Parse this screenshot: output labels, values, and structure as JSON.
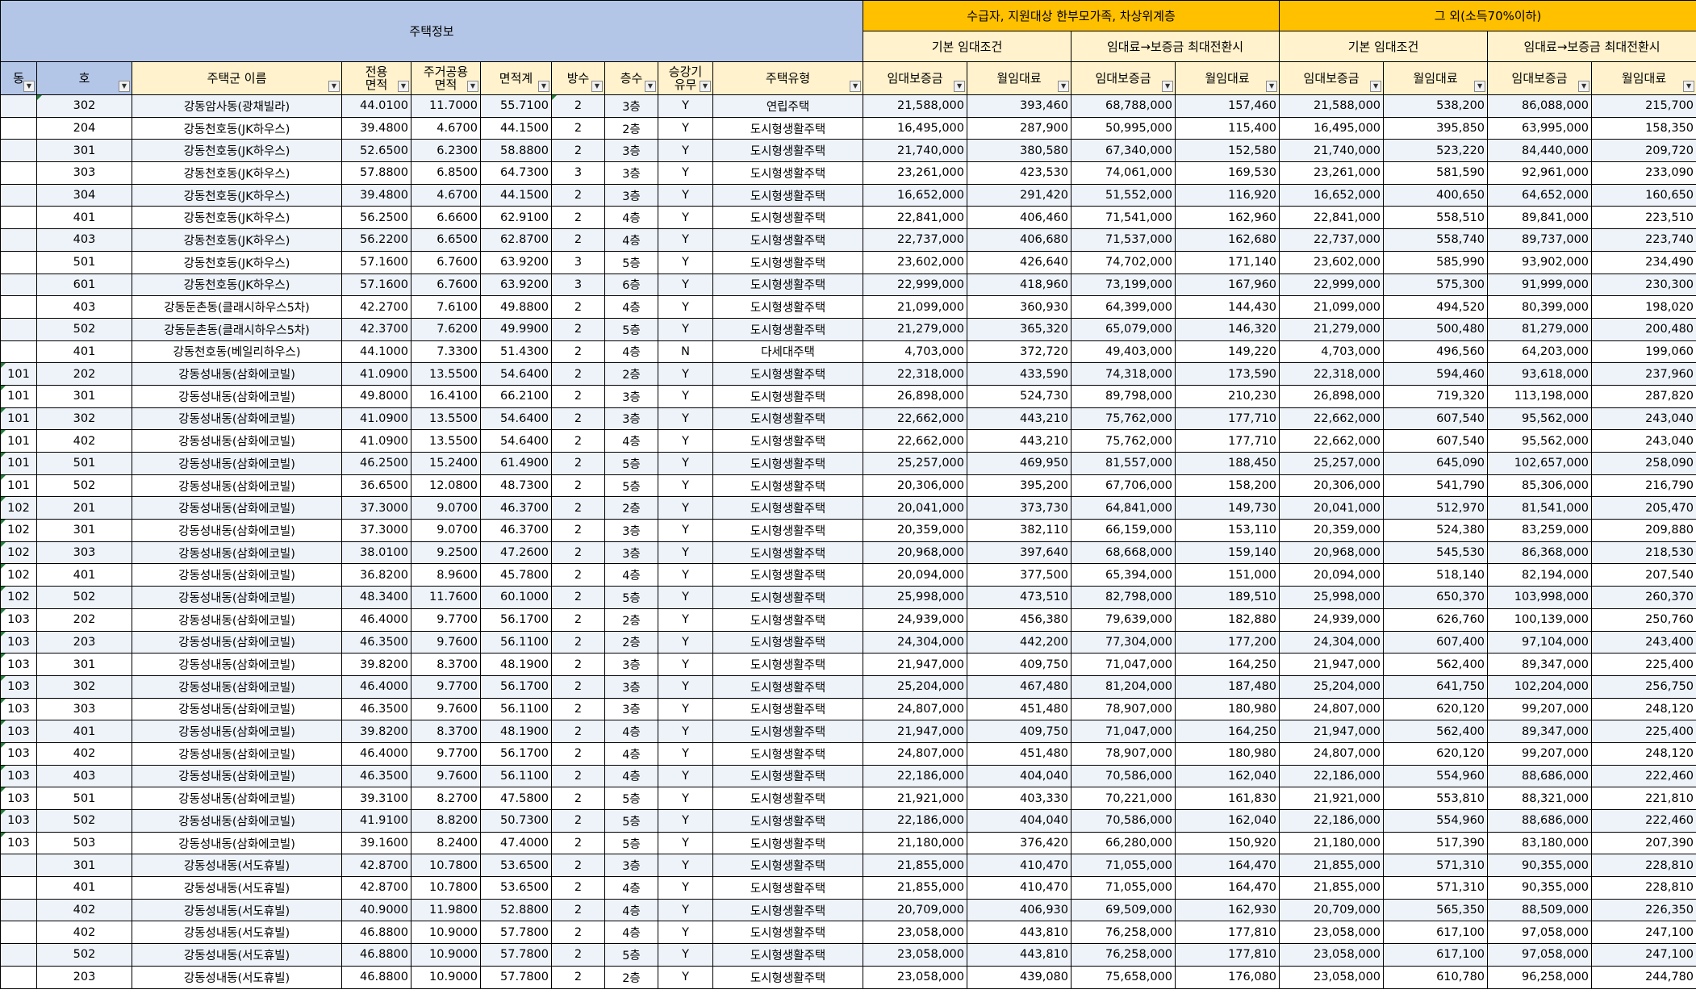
{
  "header": {
    "housing_info": "주택정보",
    "group1": "수급자, 지원대상 한부모가족, 차상위계층",
    "group2": "그 외(소득70%이하)",
    "basic1": "기본 임대조건",
    "convert1": "임대료→보증금 최대전환시",
    "basic2": "기본 임대조건",
    "convert2": "임대료→보증금 최대전환시"
  },
  "columns": {
    "dong": "동",
    "ho": "호",
    "complex": "주택군 이름",
    "area1": "전용\n면적",
    "area2": "주거공용\n면적",
    "area_total": "면적계",
    "rooms": "방수",
    "floor": "층수",
    "elevator": "승강기\n유무",
    "type": "주택유형",
    "dep1": "임대보증금",
    "rent1": "월임대료",
    "dep2": "임대보증금",
    "rent2": "월임대료",
    "dep3": "임대보증금",
    "rent3": "월임대료",
    "dep4": "임대보증금",
    "rent4": "월임대료"
  },
  "icons": {
    "filter": "filter-dropdown-icon"
  },
  "rows": [
    [
      "",
      "302",
      "강동암사동(광채빌라)",
      "44.0100",
      "11.7000",
      "55.7100",
      "2",
      "3층",
      "Y",
      "연립주택",
      "21,588,000",
      "393,460",
      "68,788,000",
      "157,460",
      "21,588,000",
      "538,200",
      "86,088,000",
      "215,700"
    ],
    [
      "",
      "204",
      "강동천호동(JK하우스)",
      "39.4800",
      "4.6700",
      "44.1500",
      "2",
      "2층",
      "Y",
      "도시형생활주택",
      "16,495,000",
      "287,900",
      "50,995,000",
      "115,400",
      "16,495,000",
      "395,850",
      "63,995,000",
      "158,350"
    ],
    [
      "",
      "301",
      "강동천호동(JK하우스)",
      "52.6500",
      "6.2300",
      "58.8800",
      "2",
      "3층",
      "Y",
      "도시형생활주택",
      "21,740,000",
      "380,580",
      "67,340,000",
      "152,580",
      "21,740,000",
      "523,220",
      "84,440,000",
      "209,720"
    ],
    [
      "",
      "303",
      "강동천호동(JK하우스)",
      "57.8800",
      "6.8500",
      "64.7300",
      "3",
      "3층",
      "Y",
      "도시형생활주택",
      "23,261,000",
      "423,530",
      "74,061,000",
      "169,530",
      "23,261,000",
      "581,590",
      "92,961,000",
      "233,090"
    ],
    [
      "",
      "304",
      "강동천호동(JK하우스)",
      "39.4800",
      "4.6700",
      "44.1500",
      "2",
      "3층",
      "Y",
      "도시형생활주택",
      "16,652,000",
      "291,420",
      "51,552,000",
      "116,920",
      "16,652,000",
      "400,650",
      "64,652,000",
      "160,650"
    ],
    [
      "",
      "401",
      "강동천호동(JK하우스)",
      "56.2500",
      "6.6600",
      "62.9100",
      "2",
      "4층",
      "Y",
      "도시형생활주택",
      "22,841,000",
      "406,460",
      "71,541,000",
      "162,960",
      "22,841,000",
      "558,510",
      "89,841,000",
      "223,510"
    ],
    [
      "",
      "403",
      "강동천호동(JK하우스)",
      "56.2200",
      "6.6500",
      "62.8700",
      "2",
      "4층",
      "Y",
      "도시형생활주택",
      "22,737,000",
      "406,680",
      "71,537,000",
      "162,680",
      "22,737,000",
      "558,740",
      "89,737,000",
      "223,740"
    ],
    [
      "",
      "501",
      "강동천호동(JK하우스)",
      "57.1600",
      "6.7600",
      "63.9200",
      "3",
      "5층",
      "Y",
      "도시형생활주택",
      "23,602,000",
      "426,640",
      "74,702,000",
      "171,140",
      "23,602,000",
      "585,990",
      "93,902,000",
      "234,490"
    ],
    [
      "",
      "601",
      "강동천호동(JK하우스)",
      "57.1600",
      "6.7600",
      "63.9200",
      "3",
      "6층",
      "Y",
      "도시형생활주택",
      "22,999,000",
      "418,960",
      "73,199,000",
      "167,960",
      "22,999,000",
      "575,300",
      "91,999,000",
      "230,300"
    ],
    [
      "",
      "403",
      "강동둔촌동(클래시하우스5차)",
      "42.2700",
      "7.6100",
      "49.8800",
      "2",
      "4층",
      "Y",
      "도시형생활주택",
      "21,099,000",
      "360,930",
      "64,399,000",
      "144,430",
      "21,099,000",
      "494,520",
      "80,399,000",
      "198,020"
    ],
    [
      "",
      "502",
      "강동둔촌동(클래시하우스5차)",
      "42.3700",
      "7.6200",
      "49.9900",
      "2",
      "5층",
      "Y",
      "도시형생활주택",
      "21,279,000",
      "365,320",
      "65,079,000",
      "146,320",
      "21,279,000",
      "500,480",
      "81,279,000",
      "200,480"
    ],
    [
      "",
      "401",
      "강동천호동(베일리하우스)",
      "44.1000",
      "7.3300",
      "51.4300",
      "2",
      "4층",
      "N",
      "다세대주택",
      "4,703,000",
      "372,720",
      "49,403,000",
      "149,220",
      "4,703,000",
      "496,560",
      "64,203,000",
      "199,060"
    ],
    [
      "101",
      "202",
      "강동성내동(삼화에코빌)",
      "41.0900",
      "13.5500",
      "54.6400",
      "2",
      "2층",
      "Y",
      "도시형생활주택",
      "22,318,000",
      "433,590",
      "74,318,000",
      "173,590",
      "22,318,000",
      "594,460",
      "93,618,000",
      "237,960"
    ],
    [
      "101",
      "301",
      "강동성내동(삼화에코빌)",
      "49.8000",
      "16.4100",
      "66.2100",
      "2",
      "3층",
      "Y",
      "도시형생활주택",
      "26,898,000",
      "524,730",
      "89,798,000",
      "210,230",
      "26,898,000",
      "719,320",
      "113,198,000",
      "287,820"
    ],
    [
      "101",
      "302",
      "강동성내동(삼화에코빌)",
      "41.0900",
      "13.5500",
      "54.6400",
      "2",
      "3층",
      "Y",
      "도시형생활주택",
      "22,662,000",
      "443,210",
      "75,762,000",
      "177,710",
      "22,662,000",
      "607,540",
      "95,562,000",
      "243,040"
    ],
    [
      "101",
      "402",
      "강동성내동(삼화에코빌)",
      "41.0900",
      "13.5500",
      "54.6400",
      "2",
      "4층",
      "Y",
      "도시형생활주택",
      "22,662,000",
      "443,210",
      "75,762,000",
      "177,710",
      "22,662,000",
      "607,540",
      "95,562,000",
      "243,040"
    ],
    [
      "101",
      "501",
      "강동성내동(삼화에코빌)",
      "46.2500",
      "15.2400",
      "61.4900",
      "2",
      "5층",
      "Y",
      "도시형생활주택",
      "25,257,000",
      "469,950",
      "81,557,000",
      "188,450",
      "25,257,000",
      "645,090",
      "102,657,000",
      "258,090"
    ],
    [
      "101",
      "502",
      "강동성내동(삼화에코빌)",
      "36.6500",
      "12.0800",
      "48.7300",
      "2",
      "5층",
      "Y",
      "도시형생활주택",
      "20,306,000",
      "395,200",
      "67,706,000",
      "158,200",
      "20,306,000",
      "541,790",
      "85,306,000",
      "216,790"
    ],
    [
      "102",
      "201",
      "강동성내동(삼화에코빌)",
      "37.3000",
      "9.0700",
      "46.3700",
      "2",
      "2층",
      "Y",
      "도시형생활주택",
      "20,041,000",
      "373,730",
      "64,841,000",
      "149,730",
      "20,041,000",
      "512,970",
      "81,541,000",
      "205,470"
    ],
    [
      "102",
      "301",
      "강동성내동(삼화에코빌)",
      "37.3000",
      "9.0700",
      "46.3700",
      "2",
      "3층",
      "Y",
      "도시형생활주택",
      "20,359,000",
      "382,110",
      "66,159,000",
      "153,110",
      "20,359,000",
      "524,380",
      "83,259,000",
      "209,880"
    ],
    [
      "102",
      "303",
      "강동성내동(삼화에코빌)",
      "38.0100",
      "9.2500",
      "47.2600",
      "2",
      "3층",
      "Y",
      "도시형생활주택",
      "20,968,000",
      "397,640",
      "68,668,000",
      "159,140",
      "20,968,000",
      "545,530",
      "86,368,000",
      "218,530"
    ],
    [
      "102",
      "401",
      "강동성내동(삼화에코빌)",
      "36.8200",
      "8.9600",
      "45.7800",
      "2",
      "4층",
      "Y",
      "도시형생활주택",
      "20,094,000",
      "377,500",
      "65,394,000",
      "151,000",
      "20,094,000",
      "518,140",
      "82,194,000",
      "207,540"
    ],
    [
      "102",
      "502",
      "강동성내동(삼화에코빌)",
      "48.3400",
      "11.7600",
      "60.1000",
      "2",
      "5층",
      "Y",
      "도시형생활주택",
      "25,998,000",
      "473,510",
      "82,798,000",
      "189,510",
      "25,998,000",
      "650,370",
      "103,998,000",
      "260,370"
    ],
    [
      "103",
      "202",
      "강동성내동(삼화에코빌)",
      "46.4000",
      "9.7700",
      "56.1700",
      "2",
      "2층",
      "Y",
      "도시형생활주택",
      "24,939,000",
      "456,380",
      "79,639,000",
      "182,880",
      "24,939,000",
      "626,760",
      "100,139,000",
      "250,760"
    ],
    [
      "103",
      "203",
      "강동성내동(삼화에코빌)",
      "46.3500",
      "9.7600",
      "56.1100",
      "2",
      "2층",
      "Y",
      "도시형생활주택",
      "24,304,000",
      "442,200",
      "77,304,000",
      "177,200",
      "24,304,000",
      "607,400",
      "97,104,000",
      "243,400"
    ],
    [
      "103",
      "301",
      "강동성내동(삼화에코빌)",
      "39.8200",
      "8.3700",
      "48.1900",
      "2",
      "3층",
      "Y",
      "도시형생활주택",
      "21,947,000",
      "409,750",
      "71,047,000",
      "164,250",
      "21,947,000",
      "562,400",
      "89,347,000",
      "225,400"
    ],
    [
      "103",
      "302",
      "강동성내동(삼화에코빌)",
      "46.4000",
      "9.7700",
      "56.1700",
      "2",
      "3층",
      "Y",
      "도시형생활주택",
      "25,204,000",
      "467,480",
      "81,204,000",
      "187,480",
      "25,204,000",
      "641,750",
      "102,204,000",
      "256,750"
    ],
    [
      "103",
      "303",
      "강동성내동(삼화에코빌)",
      "46.3500",
      "9.7600",
      "56.1100",
      "2",
      "3층",
      "Y",
      "도시형생활주택",
      "24,807,000",
      "451,480",
      "78,907,000",
      "180,980",
      "24,807,000",
      "620,120",
      "99,207,000",
      "248,120"
    ],
    [
      "103",
      "401",
      "강동성내동(삼화에코빌)",
      "39.8200",
      "8.3700",
      "48.1900",
      "2",
      "4층",
      "Y",
      "도시형생활주택",
      "21,947,000",
      "409,750",
      "71,047,000",
      "164,250",
      "21,947,000",
      "562,400",
      "89,347,000",
      "225,400"
    ],
    [
      "103",
      "402",
      "강동성내동(삼화에코빌)",
      "46.4000",
      "9.7700",
      "56.1700",
      "2",
      "4층",
      "Y",
      "도시형생활주택",
      "24,807,000",
      "451,480",
      "78,907,000",
      "180,980",
      "24,807,000",
      "620,120",
      "99,207,000",
      "248,120"
    ],
    [
      "103",
      "403",
      "강동성내동(삼화에코빌)",
      "46.3500",
      "9.7600",
      "56.1100",
      "2",
      "4층",
      "Y",
      "도시형생활주택",
      "22,186,000",
      "404,040",
      "70,586,000",
      "162,040",
      "22,186,000",
      "554,960",
      "88,686,000",
      "222,460"
    ],
    [
      "103",
      "501",
      "강동성내동(삼화에코빌)",
      "39.3100",
      "8.2700",
      "47.5800",
      "2",
      "5층",
      "Y",
      "도시형생활주택",
      "21,921,000",
      "403,330",
      "70,221,000",
      "161,830",
      "21,921,000",
      "553,810",
      "88,321,000",
      "221,810"
    ],
    [
      "103",
      "502",
      "강동성내동(삼화에코빌)",
      "41.9100",
      "8.8200",
      "50.7300",
      "2",
      "5층",
      "Y",
      "도시형생활주택",
      "22,186,000",
      "404,040",
      "70,586,000",
      "162,040",
      "22,186,000",
      "554,960",
      "88,686,000",
      "222,460"
    ],
    [
      "103",
      "503",
      "강동성내동(삼화에코빌)",
      "39.1600",
      "8.2400",
      "47.4000",
      "2",
      "5층",
      "Y",
      "도시형생활주택",
      "21,180,000",
      "376,420",
      "66,280,000",
      "150,920",
      "21,180,000",
      "517,390",
      "83,180,000",
      "207,390"
    ],
    [
      "",
      "301",
      "강동성내동(서도휴빌)",
      "42.8700",
      "10.7800",
      "53.6500",
      "2",
      "3층",
      "Y",
      "도시형생활주택",
      "21,855,000",
      "410,470",
      "71,055,000",
      "164,470",
      "21,855,000",
      "571,310",
      "90,355,000",
      "228,810"
    ],
    [
      "",
      "401",
      "강동성내동(서도휴빌)",
      "42.8700",
      "10.7800",
      "53.6500",
      "2",
      "4층",
      "Y",
      "도시형생활주택",
      "21,855,000",
      "410,470",
      "71,055,000",
      "164,470",
      "21,855,000",
      "571,310",
      "90,355,000",
      "228,810"
    ],
    [
      "",
      "402",
      "강동성내동(서도휴빌)",
      "40.9000",
      "11.9800",
      "52.8800",
      "2",
      "4층",
      "Y",
      "도시형생활주택",
      "20,709,000",
      "406,930",
      "69,509,000",
      "162,930",
      "20,709,000",
      "565,350",
      "88,509,000",
      "226,350"
    ],
    [
      "",
      "402",
      "강동성내동(서도휴빌)",
      "46.8800",
      "10.9000",
      "57.7800",
      "2",
      "4층",
      "Y",
      "도시형생활주택",
      "23,058,000",
      "443,810",
      "76,258,000",
      "177,810",
      "23,058,000",
      "617,100",
      "97,058,000",
      "247,100"
    ],
    [
      "",
      "502",
      "강동성내동(서도휴빌)",
      "46.8800",
      "10.9000",
      "57.7800",
      "2",
      "5층",
      "Y",
      "도시형생활주택",
      "23,058,000",
      "443,810",
      "76,258,000",
      "177,810",
      "23,058,000",
      "617,100",
      "97,058,000",
      "247,100"
    ],
    [
      "",
      "203",
      "강동성내동(서도휴빌)",
      "46.8800",
      "10.9000",
      "57.7800",
      "2",
      "2층",
      "Y",
      "도시형생활주택",
      "23,058,000",
      "439,080",
      "75,658,000",
      "176,080",
      "23,058,000",
      "610,780",
      "96,258,000",
      "244,780"
    ]
  ]
}
